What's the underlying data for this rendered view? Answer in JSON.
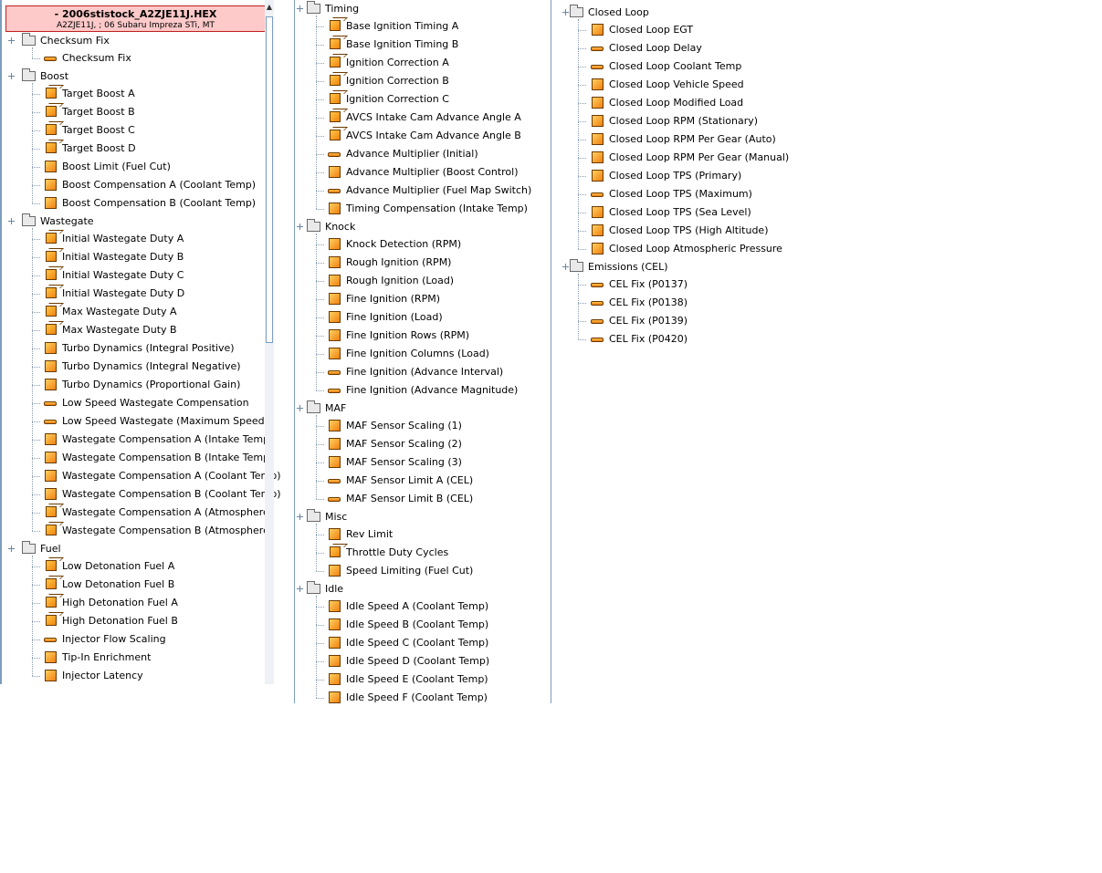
{
  "rom_header": {
    "filename": "- 2006stistock_A2ZJE11J.HEX",
    "description": "A2ZJE11J, ; 06 Subaru Impreza STi, MT"
  },
  "scrollbar": {
    "up_arrow_icon": "arrow-up-icon"
  },
  "icon_legend": {
    "3D": "3d-table-icon",
    "2D": "2d-table-icon",
    "1D": "1d-scalar-icon",
    "category": "folder-icon"
  },
  "columns": [
    {
      "categories": [
        {
          "name": "Checksum Fix",
          "items": [
            {
              "label": "Checksum Fix",
              "type": "1D"
            }
          ]
        },
        {
          "name": "Boost",
          "items": [
            {
              "label": "Target Boost A",
              "type": "3D"
            },
            {
              "label": "Target Boost B",
              "type": "3D"
            },
            {
              "label": "Target Boost C",
              "type": "3D"
            },
            {
              "label": "Target Boost D",
              "type": "3D"
            },
            {
              "label": "Boost Limit (Fuel Cut)",
              "type": "2D"
            },
            {
              "label": "Boost Compensation A (Coolant Temp)",
              "type": "2D"
            },
            {
              "label": "Boost Compensation B (Coolant Temp)",
              "type": "2D"
            }
          ]
        },
        {
          "name": "Wastegate",
          "items": [
            {
              "label": "Initial Wastegate Duty A",
              "type": "3D"
            },
            {
              "label": "Initial Wastegate Duty B",
              "type": "3D"
            },
            {
              "label": "Initial Wastegate Duty C",
              "type": "3D"
            },
            {
              "label": "Initial Wastegate Duty D",
              "type": "3D"
            },
            {
              "label": "Max Wastegate Duty A",
              "type": "3D"
            },
            {
              "label": "Max Wastegate Duty B",
              "type": "3D"
            },
            {
              "label": "Turbo Dynamics (Integral Positive)",
              "type": "2D"
            },
            {
              "label": "Turbo Dynamics (Integral Negative)",
              "type": "2D"
            },
            {
              "label": "Turbo Dynamics (Proportional Gain)",
              "type": "2D"
            },
            {
              "label": "Low Speed Wastegate Compensation",
              "type": "1D"
            },
            {
              "label": "Low Speed Wastegate (Maximum Speed)",
              "type": "1D"
            },
            {
              "label": "Wastegate Compensation A (Intake Temp)",
              "type": "2D"
            },
            {
              "label": "Wastegate Compensation B (Intake Temp)",
              "type": "2D"
            },
            {
              "label": "Wastegate Compensation A (Coolant Temp)",
              "type": "2D"
            },
            {
              "label": "Wastegate Compensation B (Coolant Temp)",
              "type": "2D"
            },
            {
              "label": "Wastegate Compensation A (Atmosphere)",
              "type": "3D"
            },
            {
              "label": "Wastegate Compensation B (Atmosphere)",
              "type": "3D"
            }
          ]
        },
        {
          "name": "Fuel",
          "items": [
            {
              "label": "Low Detonation Fuel A",
              "type": "3D"
            },
            {
              "label": "Low Detonation Fuel B",
              "type": "3D"
            },
            {
              "label": "High Detonation Fuel A",
              "type": "3D"
            },
            {
              "label": "High Detonation Fuel B",
              "type": "3D"
            },
            {
              "label": "Injector Flow Scaling",
              "type": "1D"
            },
            {
              "label": "Tip-In Enrichment",
              "type": "2D"
            },
            {
              "label": "Injector Latency",
              "type": "2D"
            }
          ]
        }
      ]
    },
    {
      "categories": [
        {
          "name": "Timing",
          "items": [
            {
              "label": "Base Ignition Timing A",
              "type": "3D"
            },
            {
              "label": "Base Ignition Timing B",
              "type": "3D"
            },
            {
              "label": "Ignition Correction A",
              "type": "3D"
            },
            {
              "label": "Ignition Correction B",
              "type": "3D"
            },
            {
              "label": "Ignition Correction C",
              "type": "3D"
            },
            {
              "label": "AVCS Intake Cam Advance Angle A",
              "type": "3D"
            },
            {
              "label": "AVCS Intake Cam Advance Angle B",
              "type": "3D"
            },
            {
              "label": "Advance Multiplier (Initial)",
              "type": "1D"
            },
            {
              "label": "Advance Multiplier (Boost Control)",
              "type": "2D"
            },
            {
              "label": "Advance Multiplier (Fuel Map Switch)",
              "type": "1D"
            },
            {
              "label": "Timing Compensation (Intake Temp)",
              "type": "2D"
            }
          ]
        },
        {
          "name": "Knock",
          "items": [
            {
              "label": "Knock Detection (RPM)",
              "type": "2D"
            },
            {
              "label": "Rough Ignition (RPM)",
              "type": "2D"
            },
            {
              "label": "Rough Ignition (Load)",
              "type": "2D"
            },
            {
              "label": "Fine Ignition (RPM)",
              "type": "2D"
            },
            {
              "label": "Fine Ignition (Load)",
              "type": "2D"
            },
            {
              "label": "Fine Ignition Rows (RPM)",
              "type": "2D"
            },
            {
              "label": "Fine Ignition Columns (Load)",
              "type": "2D"
            },
            {
              "label": "Fine Ignition (Advance Interval)",
              "type": "1D"
            },
            {
              "label": "Fine Ignition (Advance Magnitude)",
              "type": "1D"
            }
          ]
        },
        {
          "name": "MAF",
          "items": [
            {
              "label": "MAF Sensor Scaling (1)",
              "type": "2D"
            },
            {
              "label": "MAF Sensor Scaling (2)",
              "type": "2D"
            },
            {
              "label": "MAF Sensor Scaling (3)",
              "type": "2D"
            },
            {
              "label": "MAF Sensor Limit A (CEL)",
              "type": "1D"
            },
            {
              "label": "MAF Sensor Limit B (CEL)",
              "type": "1D"
            }
          ]
        },
        {
          "name": "Misc",
          "items": [
            {
              "label": "Rev Limit",
              "type": "2D"
            },
            {
              "label": "Throttle Duty Cycles",
              "type": "3D"
            },
            {
              "label": "Speed Limiting (Fuel Cut)",
              "type": "2D"
            }
          ]
        },
        {
          "name": "Idle",
          "items": [
            {
              "label": "Idle Speed A (Coolant Temp)",
              "type": "2D"
            },
            {
              "label": "Idle Speed B (Coolant Temp)",
              "type": "2D"
            },
            {
              "label": "Idle Speed C (Coolant Temp)",
              "type": "2D"
            },
            {
              "label": "Idle Speed D (Coolant Temp)",
              "type": "2D"
            },
            {
              "label": "Idle Speed E (Coolant Temp)",
              "type": "2D"
            },
            {
              "label": "Idle Speed F (Coolant Temp)",
              "type": "2D"
            }
          ]
        }
      ]
    },
    {
      "categories": [
        {
          "name": "Closed Loop",
          "items": [
            {
              "label": "Closed Loop EGT",
              "type": "2D"
            },
            {
              "label": "Closed Loop Delay",
              "type": "1D"
            },
            {
              "label": "Closed Loop Coolant Temp",
              "type": "1D"
            },
            {
              "label": "Closed Loop Vehicle Speed",
              "type": "2D"
            },
            {
              "label": "Closed Loop Modified Load",
              "type": "2D"
            },
            {
              "label": "Closed Loop RPM (Stationary)",
              "type": "2D"
            },
            {
              "label": "Closed Loop RPM Per Gear (Auto)",
              "type": "2D"
            },
            {
              "label": "Closed Loop RPM Per Gear (Manual)",
              "type": "2D"
            },
            {
              "label": "Closed Loop TPS (Primary)",
              "type": "2D"
            },
            {
              "label": "Closed Loop TPS (Maximum)",
              "type": "1D"
            },
            {
              "label": "Closed Loop TPS (Sea Level)",
              "type": "2D"
            },
            {
              "label": "Closed Loop TPS (High Altitude)",
              "type": "2D"
            },
            {
              "label": "Closed Loop Atmospheric Pressure",
              "type": "2D"
            }
          ]
        },
        {
          "name": "Emissions (CEL)",
          "items": [
            {
              "label": "CEL Fix (P0137)",
              "type": "1D"
            },
            {
              "label": "CEL Fix (P0138)",
              "type": "1D"
            },
            {
              "label": "CEL Fix (P0139)",
              "type": "1D"
            },
            {
              "label": "CEL Fix (P0420)",
              "type": "1D"
            }
          ]
        }
      ]
    }
  ]
}
